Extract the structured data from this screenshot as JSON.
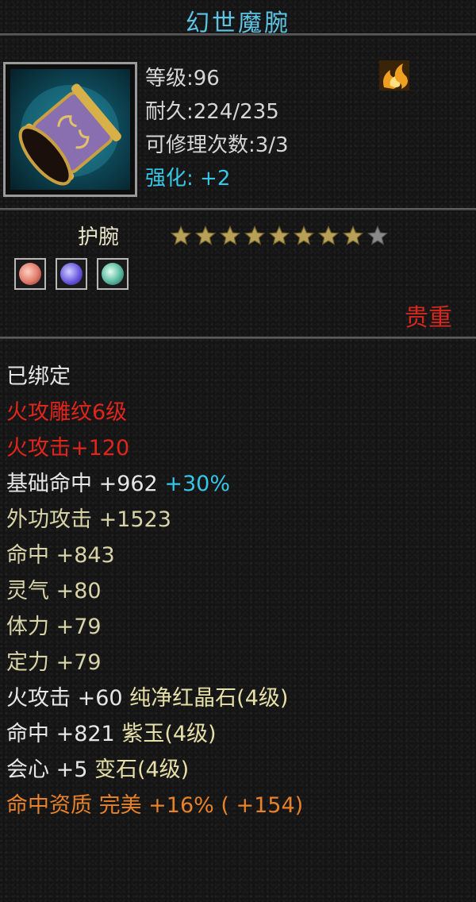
{
  "item": {
    "name": "幻世魔腕",
    "level_text": "等级:96",
    "durability_text": "耐久:224/235",
    "repair_text": "可修理次数:3/3",
    "enhance_label": "强化:",
    "enhance_value": "+2",
    "type_name": "护腕",
    "stars_total": 9,
    "stars_filled": 8,
    "quality": "贵重",
    "icon": "bracer-icon",
    "element_icon": "fire-icon",
    "gems": [
      {
        "icon": "red-gem-icon",
        "color": "#e07a6a"
      },
      {
        "icon": "purple-gem-icon",
        "color": "#6a5ae0"
      },
      {
        "icon": "green-gem-icon",
        "color": "#5ab8a0"
      }
    ]
  },
  "attributes": {
    "bound": "已绑定",
    "engraving": "火攻雕纹6级",
    "fire_attack": "火攻击+120",
    "base_hit": "基础命中  +962",
    "base_hit_pct": "+30%",
    "outer_attack": "外功攻击  +1523",
    "hit": "命中  +843",
    "spirit": "灵气  +80",
    "stamina": "体力  +79",
    "focus": "定力  +79",
    "gem1_stat": "火攻击  +60 ",
    "gem1_name": "纯净红晶石(4级)",
    "gem2_stat": "命中  +821 ",
    "gem2_name": "紫玉(4级)",
    "gem3_stat": "会心  +5 ",
    "gem3_name": "变石(4级)",
    "aptitude_label": "命中资质  ",
    "aptitude_value": "完美  +16%  ( +154)"
  },
  "colors": {
    "title": "#5ec4e4",
    "quality": "#d4281e",
    "red_text": "#e0251c",
    "cyan_text": "#35c7e8",
    "orange_text": "#e8822a"
  }
}
